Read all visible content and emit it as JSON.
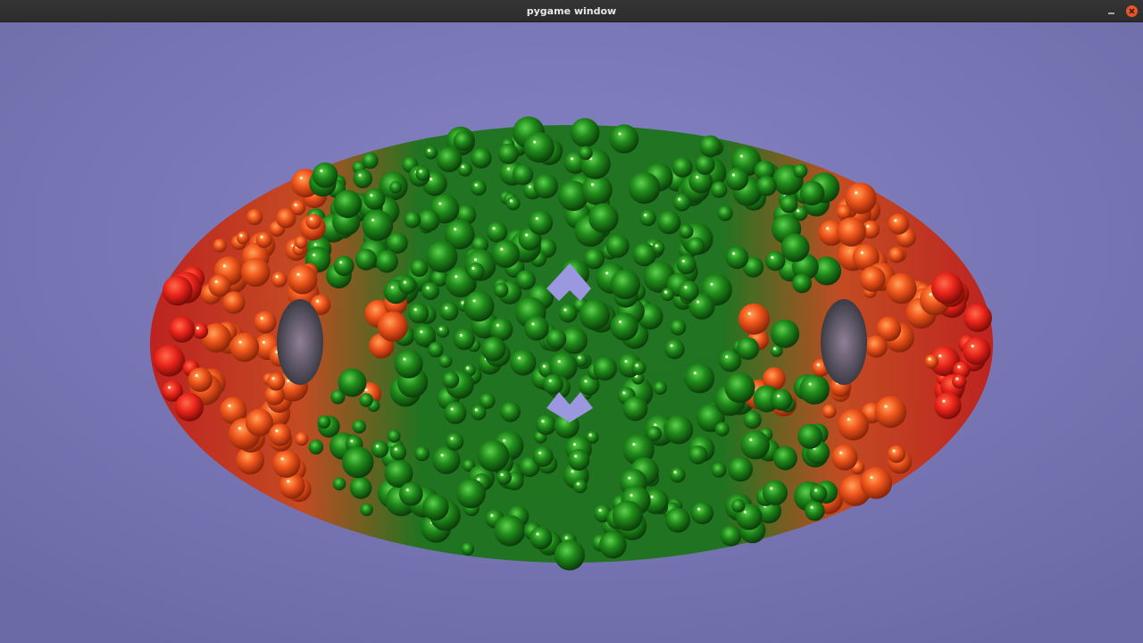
{
  "window": {
    "title": "pygame window"
  },
  "controls": {
    "minimize_icon": "minimize-icon",
    "close_icon": "close-icon"
  },
  "scene": {
    "background_color": "#7a78b6",
    "orange_color": "#f0561c",
    "green_color": "#1f8a1a",
    "dark_gap_color": "#3c3b45"
  }
}
